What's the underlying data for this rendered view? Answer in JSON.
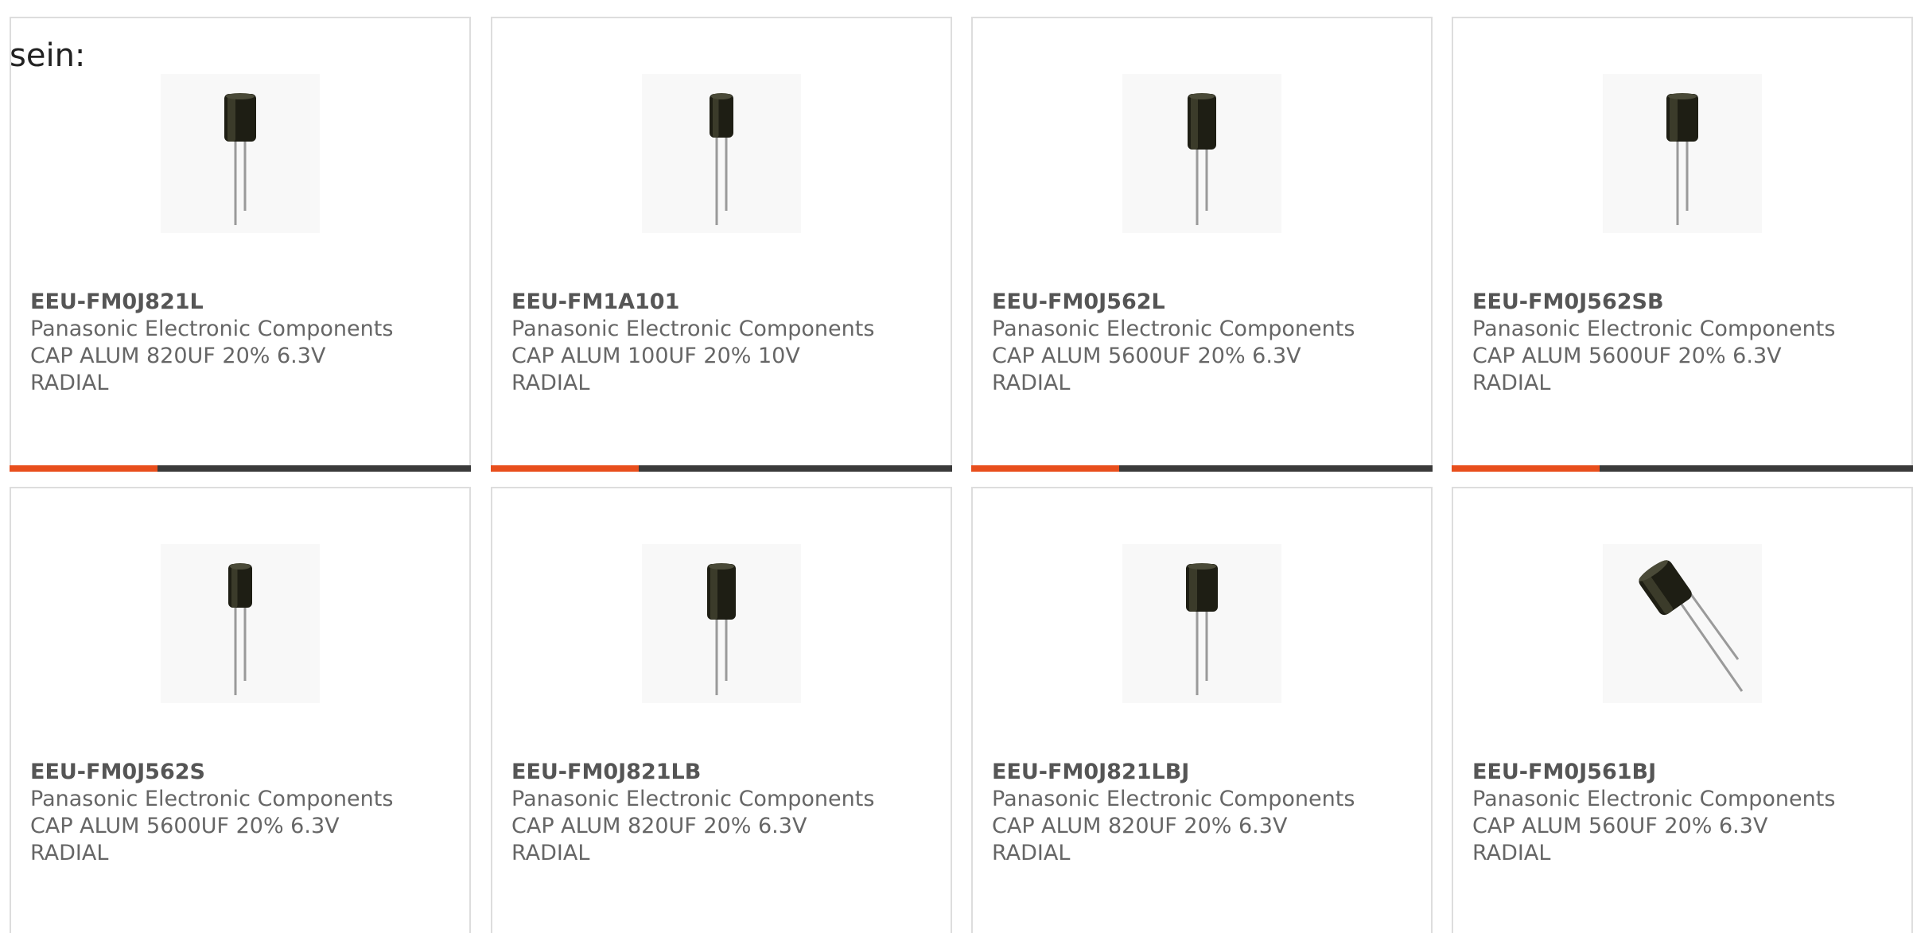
{
  "intro_text": "sein:",
  "colors": {
    "accent": "#e84e1c",
    "bar": "#3a3a3a",
    "border": "#dddddd",
    "text": "#666666"
  },
  "rows": [
    {
      "progress": 0.32,
      "products": [
        {
          "part_number": "EEU-FM0J821L",
          "manufacturer": "Panasonic Electronic Components",
          "description": "CAP ALUM 820UF 20% 6.3V RADIAL",
          "icon": "capacitor-icon"
        },
        {
          "part_number": "EEU-FM1A101",
          "manufacturer": "Panasonic Electronic Components",
          "description": "CAP ALUM 100UF 20% 10V RADIAL",
          "icon": "capacitor-icon"
        },
        {
          "part_number": "EEU-FM0J562L",
          "manufacturer": "Panasonic Electronic Components",
          "description": "CAP ALUM 5600UF 20% 6.3V RADIAL",
          "icon": "capacitor-icon"
        },
        {
          "part_number": "EEU-FM0J562SB",
          "manufacturer": "Panasonic Electronic Components",
          "description": "CAP ALUM 5600UF 20% 6.3V RADIAL",
          "icon": "capacitor-icon"
        }
      ]
    },
    {
      "progress": null,
      "products": [
        {
          "part_number": "EEU-FM0J562S",
          "manufacturer": "Panasonic Electronic Components",
          "description": "CAP ALUM 5600UF 20% 6.3V RADIAL",
          "icon": "capacitor-icon"
        },
        {
          "part_number": "EEU-FM0J821LB",
          "manufacturer": "Panasonic Electronic Components",
          "description": "CAP ALUM 820UF 20% 6.3V RADIAL",
          "icon": "capacitor-icon"
        },
        {
          "part_number": "EEU-FM0J821LBJ",
          "manufacturer": "Panasonic Electronic Components",
          "description": "CAP ALUM 820UF 20% 6.3V RADIAL",
          "icon": "capacitor-icon"
        },
        {
          "part_number": "EEU-FM0J561BJ",
          "manufacturer": "Panasonic Electronic Components",
          "description": "CAP ALUM 560UF 20% 6.3V RADIAL",
          "icon": "capacitor-icon"
        }
      ]
    }
  ]
}
